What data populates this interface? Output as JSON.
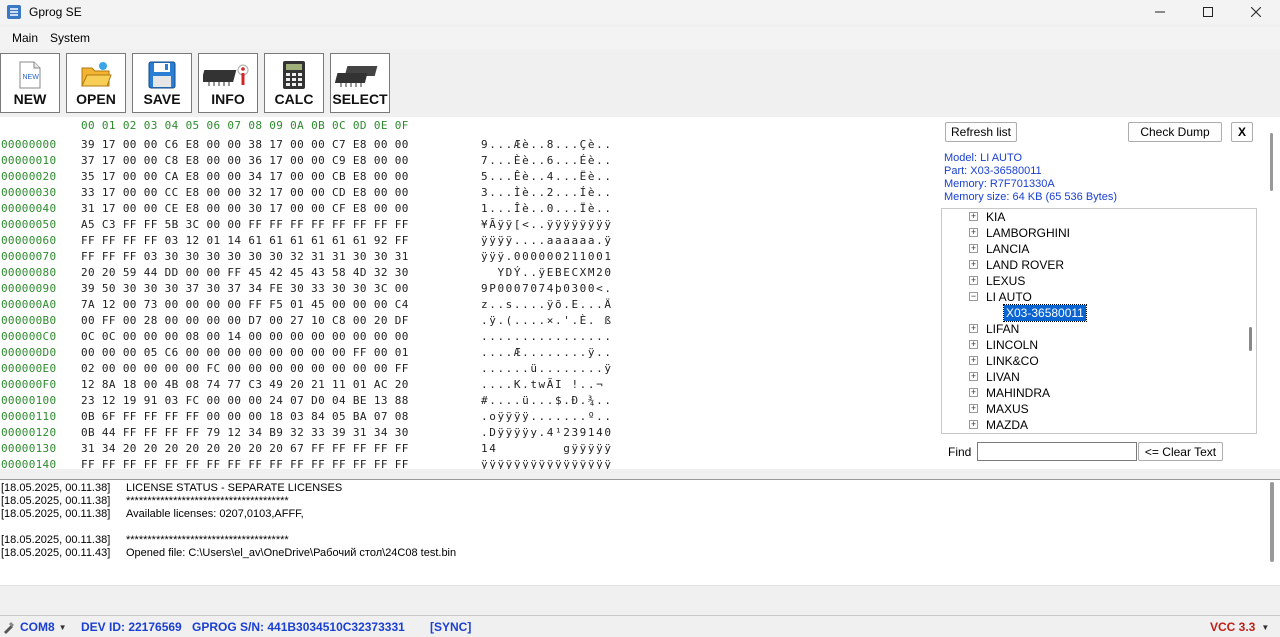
{
  "window": {
    "title": "Gprog SE"
  },
  "menu": [
    "Main",
    "System"
  ],
  "toolbar": {
    "new": "NEW",
    "new_icon_text": "NEW",
    "open": "OPEN",
    "save": "SAVE",
    "info": "INFO",
    "calc": "CALC",
    "select": "SELECT"
  },
  "hex": {
    "header": "00 01 02 03 04 05 06 07 08 09 0A 0B 0C 0D 0E 0F",
    "rows": [
      {
        "addr": "00000000",
        "bytes": "39 17 00 00 C6 E8 00 00 38 17 00 00 C7 E8 00 00",
        "ascii": "9...Æè..8...Çè.."
      },
      {
        "addr": "00000010",
        "bytes": "37 17 00 00 C8 E8 00 00 36 17 00 00 C9 E8 00 00",
        "ascii": "7...Èè..6...Éè.."
      },
      {
        "addr": "00000020",
        "bytes": "35 17 00 00 CA E8 00 00 34 17 00 00 CB E8 00 00",
        "ascii": "5...Êè..4...Ëè.."
      },
      {
        "addr": "00000030",
        "bytes": "33 17 00 00 CC E8 00 00 32 17 00 00 CD E8 00 00",
        "ascii": "3...Ìè..2...Íè.."
      },
      {
        "addr": "00000040",
        "bytes": "31 17 00 00 CE E8 00 00 30 17 00 00 CF E8 00 00",
        "ascii": "1...Îè..0...Ïè.."
      },
      {
        "addr": "00000050",
        "bytes": "A5 C3 FF FF 5B 3C 00 00 FF FF FF FF FF FF FF FF",
        "ascii": "¥Ãÿÿ[<..ÿÿÿÿÿÿÿÿ"
      },
      {
        "addr": "00000060",
        "bytes": "FF FF FF FF 03 12 01 14 61 61 61 61 61 61 92 FF",
        "ascii": "ÿÿÿÿ....aaaaaa.ÿ"
      },
      {
        "addr": "00000070",
        "bytes": "FF FF FF 03 30 30 30 30 30 30 32 31 31 30 30 31",
        "ascii": "ÿÿÿ.000000211001"
      },
      {
        "addr": "00000080",
        "bytes": "20 20 59 44 DD 00 00 FF 45 42 45 43 58 4D 32 30",
        "ascii": "  YDÝ..ÿEBECXM20"
      },
      {
        "addr": "00000090",
        "bytes": "39 50 30 30 30 37 30 37 34 FE 30 33 30 30 3C 00",
        "ascii": "9P0007074þ0300<."
      },
      {
        "addr": "000000A0",
        "bytes": "7A 12 00 73 00 00 00 00 FF F5 01 45 00 00 00 C4",
        "ascii": "z..s....ÿõ.E...Ä"
      },
      {
        "addr": "000000B0",
        "bytes": "00 FF 00 28 00 00 00 00 D7 00 27 10 C8 00 20 DF",
        "ascii": ".ÿ.(....×.'.È. ß"
      },
      {
        "addr": "000000C0",
        "bytes": "0C 0C 00 00 00 08 00 14 00 00 00 00 00 00 00 00",
        "ascii": "................"
      },
      {
        "addr": "000000D0",
        "bytes": "00 00 00 05 C6 00 00 00 00 00 00 00 00 FF 00 01",
        "ascii": "....Æ........ÿ.."
      },
      {
        "addr": "000000E0",
        "bytes": "02 00 00 00 00 00 FC 00 00 00 00 00 00 00 00 FF",
        "ascii": "......ü........ÿ"
      },
      {
        "addr": "000000F0",
        "bytes": "12 8A 18 00 4B 08 74 77 C3 49 20 21 11 01 AC 20",
        "ascii": "....K.twÃI !..¬ "
      },
      {
        "addr": "00000100",
        "bytes": "23 12 19 91 03 FC 00 00 00 24 07 D0 04 BE 13 88",
        "ascii": "#....ü...$.Ð.¾.."
      },
      {
        "addr": "00000110",
        "bytes": "0B 6F FF FF FF FF 00 00 00 18 03 84 05 BA 07 08",
        "ascii": ".oÿÿÿÿ.......º.."
      },
      {
        "addr": "00000120",
        "bytes": "0B 44 FF FF FF FF 79 12 34 B9 32 33 39 31 34 30",
        "ascii": ".Dÿÿÿÿy.4¹239140"
      },
      {
        "addr": "00000130",
        "bytes": "31 34 20 20 20 20 20 20 20 20 67 FF FF FF FF FF",
        "ascii": "14        gÿÿÿÿÿ"
      },
      {
        "addr": "00000140",
        "bytes": "FF FF FF FF FF FF FF FF FF FF FF FF FF FF FF FF",
        "ascii": "ÿÿÿÿÿÿÿÿÿÿÿÿÿÿÿÿ"
      }
    ]
  },
  "right": {
    "refresh": "Refresh list",
    "check_dump": "Check Dump",
    "close": "X",
    "model": "Model: LI AUTO",
    "part": "Part: X03-36580011",
    "memory": "Memory: R7F701330A",
    "memory_size": "Memory size:  64 KB (65 536 Bytes)",
    "tree": [
      "KIA",
      "LAMBORGHINI",
      "LANCIA",
      "LAND ROVER",
      "LEXUS",
      "LI AUTO",
      "LIFAN",
      "LINCOLN",
      "LINK&CO",
      "LIVAN",
      "MAHINDRA",
      "MAXUS",
      "MAZDA"
    ],
    "selected_child": "X03-36580011",
    "find_label": "Find",
    "find_value": "",
    "clear_text": "<= Clear Text"
  },
  "log": [
    {
      "time": "[18.05.2025, 00.11.38]",
      "msg": "LICENSE STATUS - SEPARATE LICENSES"
    },
    {
      "time": "[18.05.2025, 00.11.38]",
      "msg": "**************************************"
    },
    {
      "time": "[18.05.2025, 00.11.38]",
      "msg": "Available licenses: 0207,0103,AFFF,"
    },
    {
      "time": "",
      "msg": ""
    },
    {
      "time": "[18.05.2025, 00.11.38]",
      "msg": "**************************************"
    },
    {
      "time": "[18.05.2025, 00.11.43]",
      "msg": "Opened file: C:\\Users\\el_av\\OneDrive\\Рабочий стол\\24C08 test.bin"
    }
  ],
  "status": {
    "port": "COM8",
    "dev_id": "DEV ID: 22176569",
    "sn": "GPROG S/N:  441B3034510C32373331",
    "sync": "[SYNC]",
    "vcc": "VCC 3.3"
  }
}
